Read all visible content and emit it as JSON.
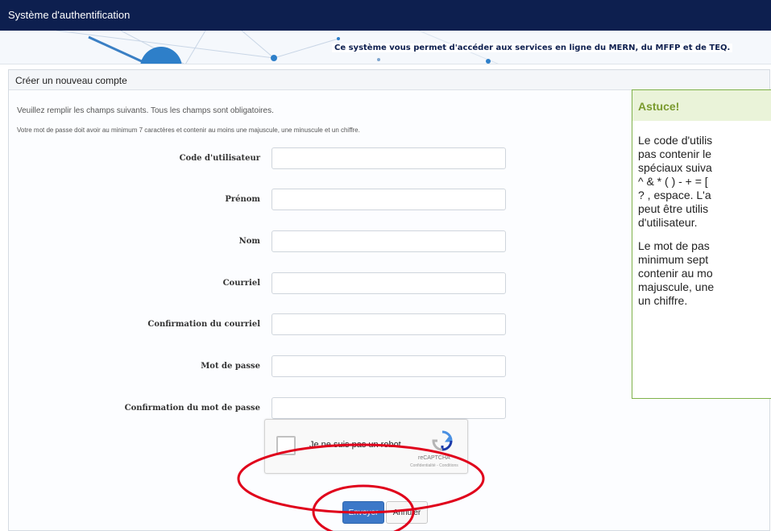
{
  "app": {
    "title": "Système d'authentification"
  },
  "banner": {
    "tagline": "Ce système vous permet d'accéder aux services en ligne du MERN, du MFFP et de TEQ."
  },
  "panel": {
    "title": "Créer un nouveau compte",
    "intro_line1": "Veuillez remplir les champs suivants. Tous les champs sont obligatoires.",
    "intro_line2": "Votre mot de passe doit avoir au minimum 7 caractères et contenir au moins une majuscule, une minuscule et un chiffre."
  },
  "form": {
    "fields": [
      {
        "label": "Code d'utilisateur",
        "value": ""
      },
      {
        "label": "Prénom",
        "value": ""
      },
      {
        "label": "Nom",
        "value": ""
      },
      {
        "label": "Courriel",
        "value": ""
      },
      {
        "label": "Confirmation du courriel",
        "value": ""
      },
      {
        "label": "Mot de passe",
        "value": ""
      },
      {
        "label": "Confirmation du mot de passe",
        "value": ""
      }
    ]
  },
  "captcha": {
    "label": "Je ne suis pas un robot",
    "brand": "reCAPTCHA",
    "terms": "Confidentialité - Conditions"
  },
  "buttons": {
    "send": "Envoyer",
    "cancel": "Annuler"
  },
  "tip": {
    "title": "Astuce!",
    "para1_lines": [
      "Le code d'utilis",
      "pas contenir le",
      "spéciaux suiva",
      "^ & * ( ) - + = [",
      "? , espace. L'a",
      "peut être utilis",
      "d'utilisateur."
    ],
    "para2_lines": [
      "Le mot de pas",
      "minimum sept",
      "contenir au mo",
      "majuscule, une",
      "un chiffre."
    ]
  },
  "colors": {
    "topbar": "#0d1f4f",
    "primary": "#3c78c8",
    "tip_border": "#7fb24a",
    "annotation": "#e0001b"
  },
  "icons": {
    "recaptcha": "recaptcha-logo-icon"
  }
}
